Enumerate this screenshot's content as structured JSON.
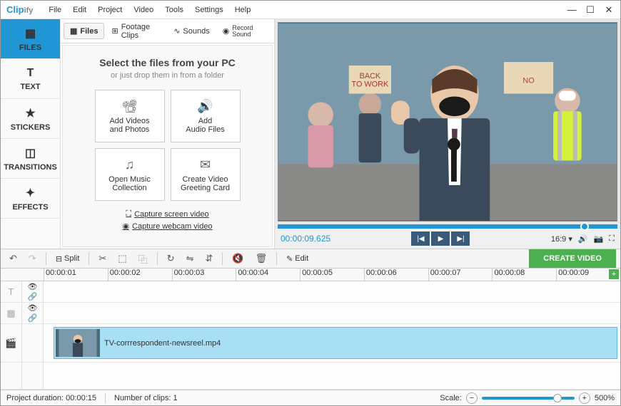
{
  "app": {
    "name": "Clipify"
  },
  "menu": [
    "File",
    "Edit",
    "Project",
    "Video",
    "Tools",
    "Settings",
    "Help"
  ],
  "leftnav": [
    {
      "label": "FILES",
      "icon": "▦"
    },
    {
      "label": "TEXT",
      "icon": "T"
    },
    {
      "label": "STICKERS",
      "icon": "★"
    },
    {
      "label": "TRANSITIONS",
      "icon": "◫"
    },
    {
      "label": "EFFECTS",
      "icon": "✦"
    }
  ],
  "tabs": [
    {
      "label": "Files",
      "icon": "▦"
    },
    {
      "label": "Footage Clips",
      "icon": "⊞"
    },
    {
      "label": "Sounds",
      "icon": "∿"
    },
    {
      "label": "Record Sound",
      "icon": "◉"
    }
  ],
  "filespanel": {
    "title": "Select the files from your PC",
    "subtitle": "or just drop them in from a folder",
    "tiles": [
      {
        "line1": "Add Videos",
        "line2": "and Photos"
      },
      {
        "line1": "Add",
        "line2": "Audio Files"
      },
      {
        "line1": "Open Music",
        "line2": "Collection"
      },
      {
        "line1": "Create Video",
        "line2": "Greeting Card"
      }
    ],
    "capture_screen": "Capture screen video",
    "capture_webcam": "Capture webcam video"
  },
  "preview": {
    "timecode": "00:00:09.625",
    "aspect": "16:9"
  },
  "toolbar": {
    "split": "Split",
    "edit": "Edit",
    "create": "CREATE VIDEO"
  },
  "ruler": [
    "00:00:01",
    "00:00:02",
    "00:00:03",
    "00:00:04",
    "00:00:05",
    "00:00:06",
    "00:00:07",
    "00:00:08",
    "00:00:09"
  ],
  "clip": {
    "filename": "TV-corrrespondent-newsreel.mp4"
  },
  "status": {
    "duration_label": "Project duration:",
    "duration": "00:00:15",
    "clips_label": "Number of clips:",
    "clips": "1",
    "scale_label": "Scale:",
    "scale_value": "500%"
  }
}
